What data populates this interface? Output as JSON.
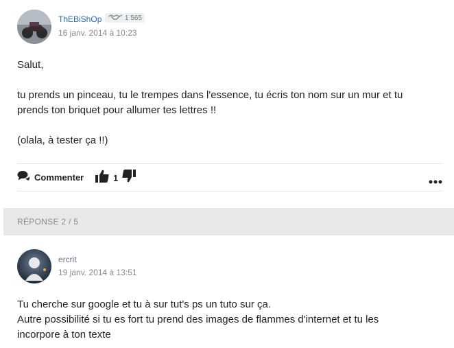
{
  "post1": {
    "username": "ThEBiShOp",
    "reputation": "1 565",
    "date": "16 janv. 2014 à 10:23",
    "lines": [
      "Salut,",
      "tu prends un pinceau, tu le trempes dans l'essence, tu écris ton nom sur un mur et tu",
      "prends ton briquet pour allumer tes lettres !!",
      "(olala, à tester ça !!)"
    ],
    "comment_label": "Commenter",
    "likes": "1"
  },
  "reply_header": "RÉPONSE 2 / 5",
  "post2": {
    "username": "ercrit",
    "date": "19 janv. 2014 à 13:51",
    "lines": [
      "Tu cherche sur google et tu à sur tut's ps un tuto sur ça.",
      "Autre possibilité si tu es fort tu prend des images de flammes d'internet et tu les",
      "incorpore à ton texte"
    ]
  },
  "icons": {
    "comment": "comment-icon",
    "thumbs_up": "thumbs-up-icon",
    "thumbs_down": "thumbs-down-icon",
    "more": "more-icon",
    "handshake": "handshake-icon"
  },
  "colors": {
    "username": "#2b6cb0",
    "band": "#e8e8e8"
  }
}
